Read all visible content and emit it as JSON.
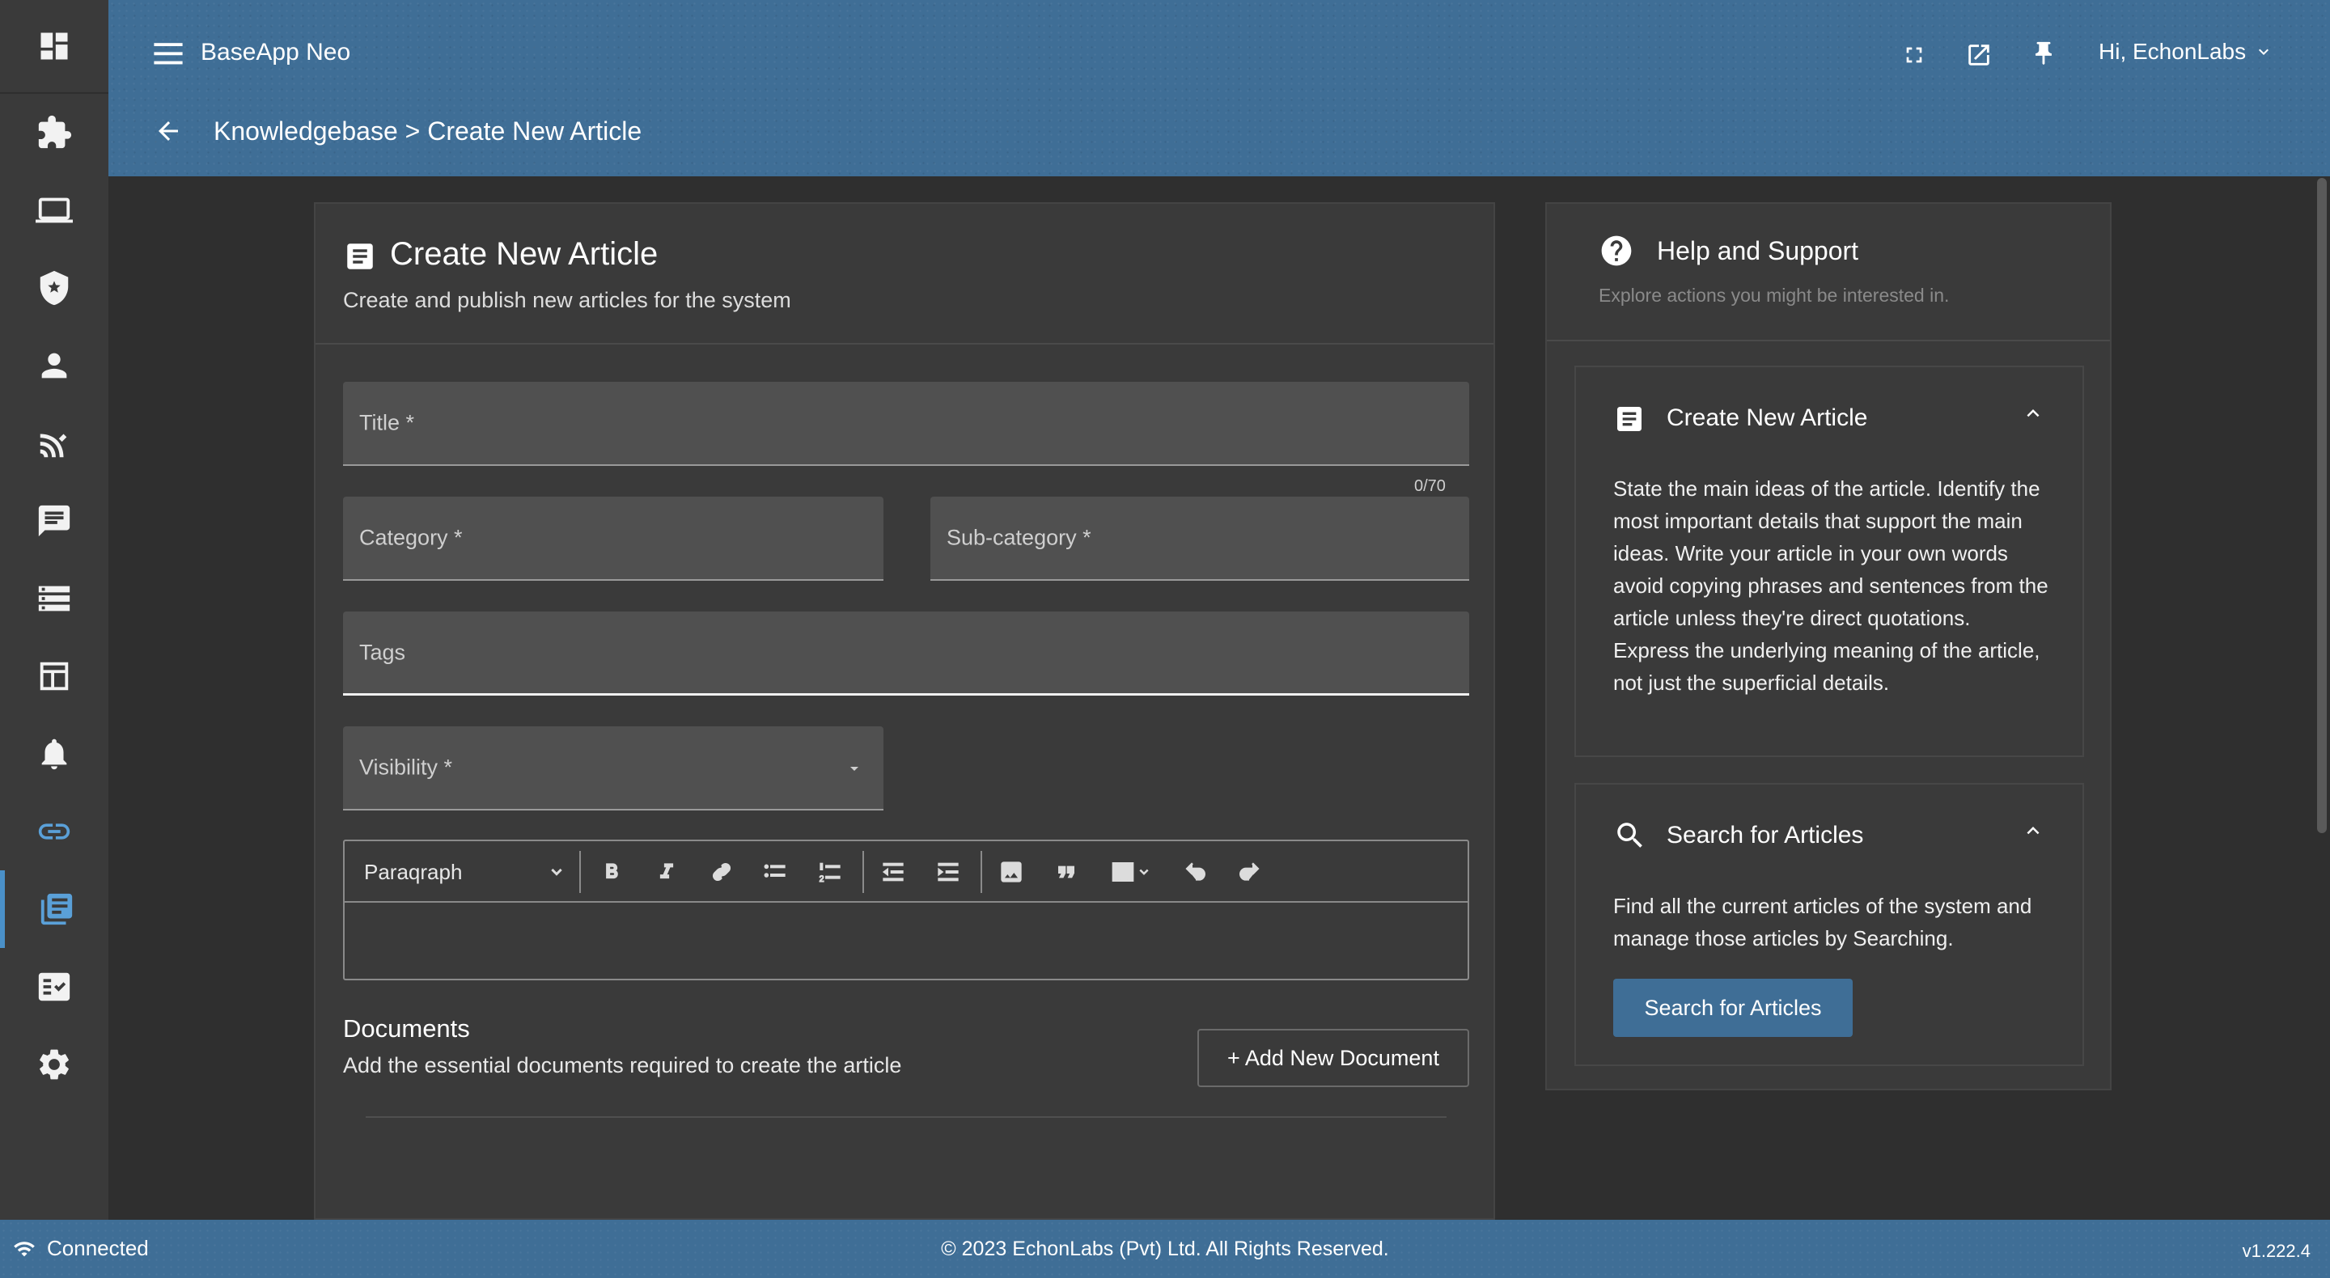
{
  "app": {
    "name": "BaseApp Neo",
    "user_greeting": "Hi, EchonLabs"
  },
  "breadcrumb": {
    "text": "Knowledgebase > Create New Article"
  },
  "sidebar": {
    "items": [
      {
        "icon": "puzzle-icon"
      },
      {
        "icon": "laptop-icon"
      },
      {
        "icon": "security-shield-icon"
      },
      {
        "icon": "person-icon"
      },
      {
        "icon": "wireless-icon"
      },
      {
        "icon": "chat-icon"
      },
      {
        "icon": "storage-icon"
      },
      {
        "icon": "table-icon"
      },
      {
        "icon": "bell-icon"
      },
      {
        "icon": "link-icon"
      },
      {
        "icon": "library-books-icon",
        "active": true
      },
      {
        "icon": "fact-check-icon"
      },
      {
        "icon": "gear-icon"
      }
    ],
    "accent_color": "#4a90c8"
  },
  "form": {
    "title": "Create New Article",
    "subtitle": "Create and publish new articles for the system",
    "title_label": "Title *",
    "title_counter": "0/70",
    "category_label": "Category *",
    "subcategory_label": "Sub-category *",
    "tags_label": "Tags",
    "visibility_label": "Visibility *",
    "editor": {
      "format_select": "Paraqraph"
    },
    "documents": {
      "title": "Documents",
      "subtitle": "Add the essential documents required to create the article",
      "add_button": "+ Add New Document"
    }
  },
  "help": {
    "title": "Help and Support",
    "subtitle": "Explore actions you might be interested in.",
    "panels": [
      {
        "title": "Create New Article",
        "body": "State the main ideas of the article. Identify the most important details that support the main ideas. Write your article in your own words avoid copying phrases and sentences from the article unless they're direct quotations. Express the underlying meaning of the article, not just the superficial details."
      },
      {
        "title": "Search for Articles",
        "body": "Find all the current articles of the system and manage those articles by Searching.",
        "button": "Search for Articles"
      }
    ]
  },
  "footer": {
    "status": "Connected",
    "copyright": "© 2023 EchonLabs (Pvt) Ltd. All Rights Reserved.",
    "version": "v1.222.4"
  },
  "colors": {
    "header": "#3f6e96",
    "sidebar": "#3a3a3a",
    "background": "#2f2f2f",
    "primary_button": "#3f6e96"
  }
}
